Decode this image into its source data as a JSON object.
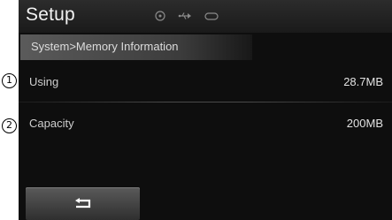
{
  "header": {
    "title": "Setup",
    "status_icons": [
      "disc-icon",
      "usb-icon",
      "aux-icon"
    ]
  },
  "breadcrumb": "System>Memory Information",
  "rows": [
    {
      "callout": "1",
      "label": "Using",
      "value": "28.7MB"
    },
    {
      "callout": "2",
      "label": "Capacity",
      "value": "200MB"
    }
  ],
  "footer": {
    "back_icon": "back-arrow-icon"
  },
  "colors": {
    "screen_bg": "#0e0e0e",
    "text": "#e2e2e2"
  }
}
